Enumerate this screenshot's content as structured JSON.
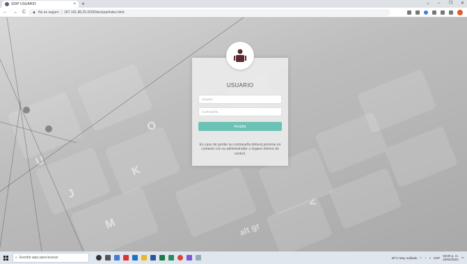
{
  "browser": {
    "tab_title": "SDIP USUARIO",
    "tab_close": "×",
    "new_tab": "+",
    "window_controls": [
      "⌄",
      "–",
      "❐"
    ],
    "back": "←",
    "forward": "→",
    "reload": "C",
    "security_warning": "▲",
    "security_label": "No es seguro",
    "separator": "|",
    "url": "187.141.88.25:2000/declara/index.html"
  },
  "login": {
    "title": "USUARIO",
    "username_placeholder": "Usuario",
    "password_placeholder": "Contraseña",
    "submit_label": "Aceptar",
    "help_text": "En caso de perder su contraseña deberá ponerse en contacto con su administrador u órgano interno de control."
  },
  "background_keys": [
    "U",
    "K",
    "J",
    "M",
    "alt gr",
    "<",
    "O"
  ],
  "taskbar": {
    "search_placeholder": "Escribir aquí para buscar",
    "weather": "30°C Muy nublado",
    "lang": "ESP",
    "time": "03:00 p. m.",
    "date": "20/04/2022"
  },
  "colors": {
    "accent": "#6cc2b4",
    "avatar_icon": "#5a2a2f"
  }
}
